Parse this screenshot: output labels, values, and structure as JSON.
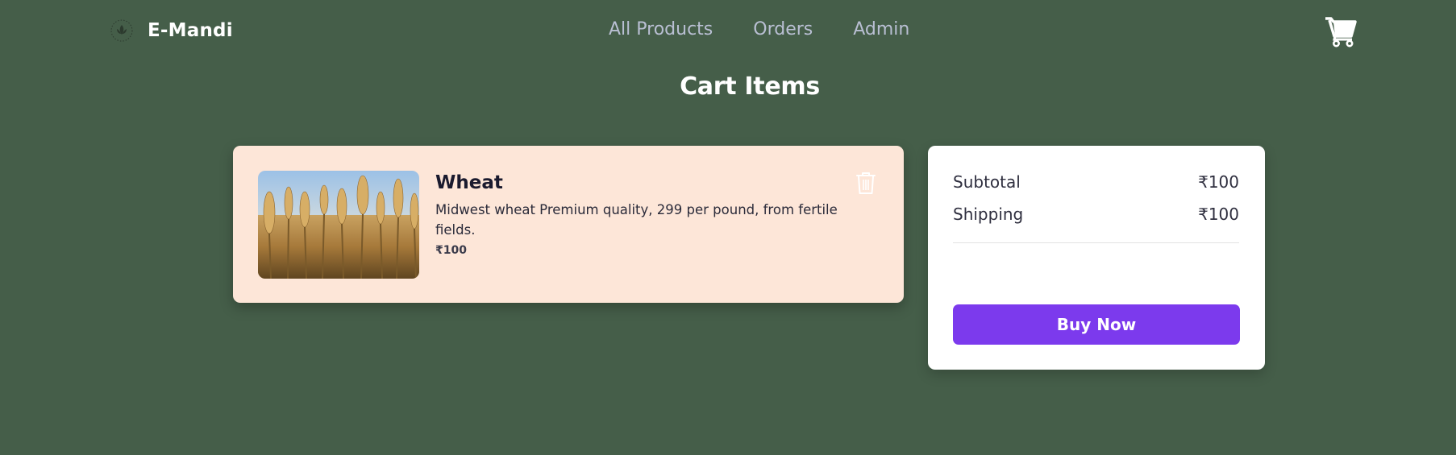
{
  "header": {
    "brand": "E-Mandi",
    "nav": [
      {
        "label": "All Products"
      },
      {
        "label": "Orders"
      },
      {
        "label": "Admin"
      }
    ]
  },
  "page": {
    "title": "Cart Items"
  },
  "cart_items": [
    {
      "name": "Wheat",
      "description": "Midwest wheat Premium quality, 299 per pound, from fertile fields.",
      "price": "₹100"
    }
  ],
  "summary": {
    "subtotal_label": "Subtotal",
    "subtotal_value": "₹100",
    "shipping_label": "Shipping",
    "shipping_value": "₹100",
    "buy_label": "Buy Now"
  },
  "colors": {
    "background": "#455e49",
    "card": "#fde6d8",
    "accent": "#7c3aed"
  },
  "icons": {
    "logo": "leaf-logo-icon",
    "cart": "shopping-cart-icon",
    "delete": "trash-icon"
  }
}
